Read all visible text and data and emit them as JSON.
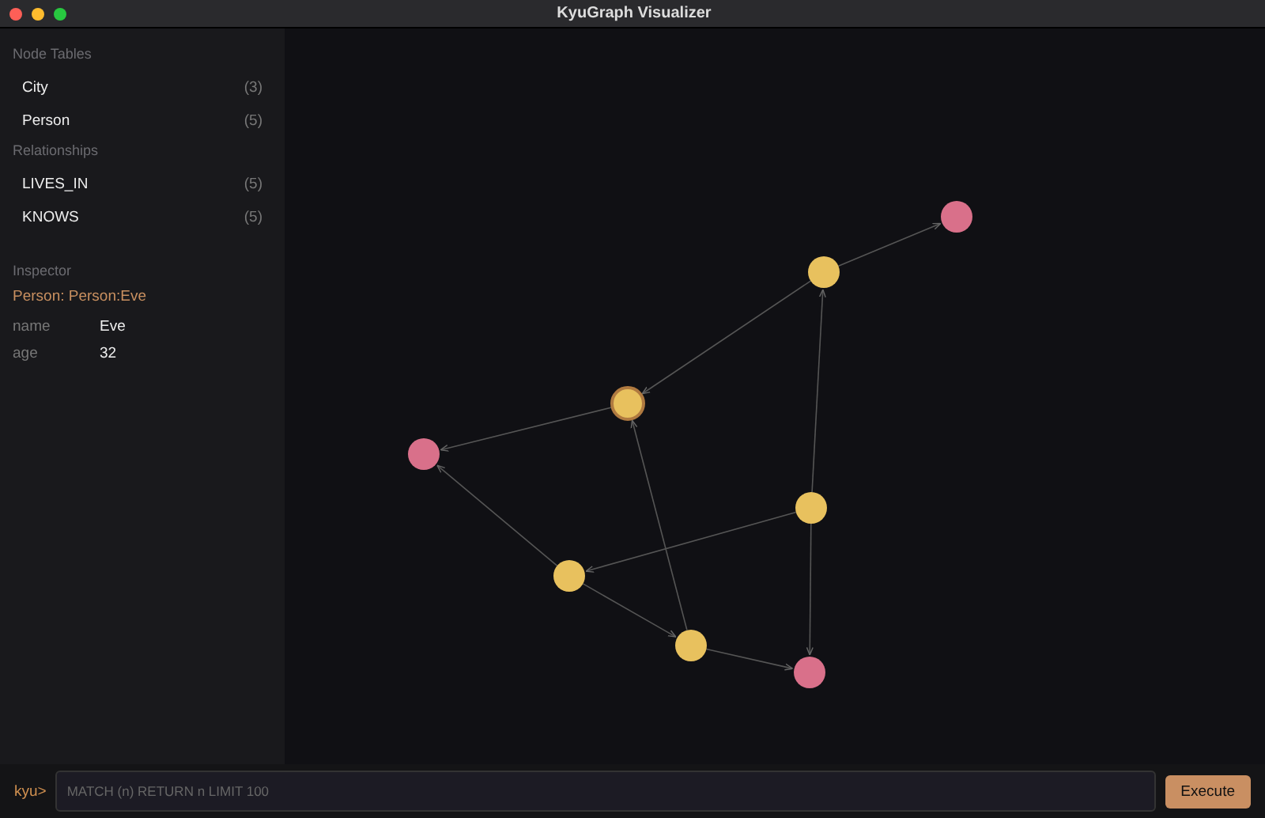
{
  "window": {
    "title": "KyuGraph Visualizer"
  },
  "sidebar": {
    "node_tables_heading": "Node Tables",
    "node_tables": [
      {
        "name": "City",
        "count": "(3)"
      },
      {
        "name": "Person",
        "count": "(5)"
      }
    ],
    "relationships_heading": "Relationships",
    "relationships": [
      {
        "name": "LIVES_IN",
        "count": "(5)"
      },
      {
        "name": "KNOWS",
        "count": "(5)"
      }
    ],
    "inspector": {
      "heading": "Inspector",
      "title": "Person: Person:Eve",
      "properties": [
        {
          "key": "name",
          "value": "Eve"
        },
        {
          "key": "age",
          "value": "32"
        }
      ]
    }
  },
  "graph": {
    "nodes": [
      {
        "color": "#d9708a",
        "selected": false
      },
      {
        "color": "#e8c15e",
        "selected": false
      },
      {
        "color": "#e8c15e",
        "selected": true
      },
      {
        "color": "#d9708a",
        "selected": false
      },
      {
        "color": "#e8c15e",
        "selected": false
      },
      {
        "color": "#e8c15e",
        "selected": false
      },
      {
        "color": "#e8c15e",
        "selected": false
      },
      {
        "color": "#d9708a",
        "selected": false
      }
    ]
  },
  "query_bar": {
    "prompt": "kyu>",
    "placeholder": "MATCH (n) RETURN n LIMIT 100",
    "button": "Execute"
  }
}
